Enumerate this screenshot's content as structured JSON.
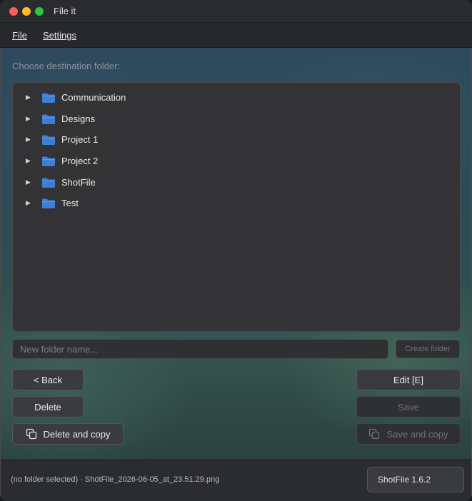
{
  "window": {
    "title": "File it"
  },
  "menu": {
    "file": "File",
    "settings": "Settings"
  },
  "main": {
    "choose_label": "Choose destination folder:",
    "folders": [
      {
        "label": "Communication",
        "icon": "folder-icon"
      },
      {
        "label": "Designs",
        "icon": "folder-icon"
      },
      {
        "label": "Project 1",
        "icon": "folder-icon"
      },
      {
        "label": "Project 2",
        "icon": "folder-icon"
      },
      {
        "label": "ShotFile",
        "icon": "folder-icon"
      },
      {
        "label": "Test",
        "icon": "folder-icon"
      }
    ],
    "new_folder": {
      "value": "",
      "placeholder": "New folder name..."
    },
    "create_folder_label": "Create folder"
  },
  "actions": {
    "back": "< Back",
    "delete": "Delete",
    "delete_and_copy": "Delete and copy",
    "edit": "Edit [E]",
    "save": "Save",
    "save_and_copy": "Save and copy"
  },
  "footer": {
    "status": "(no folder selected) · ShotFile_2026-06-05_at_23.51.29.png",
    "version": "ShotFile 1.6.2"
  },
  "colors": {
    "folder": "#3d7fd6",
    "traffic_close": "#ff5f57",
    "traffic_min": "#febc2e",
    "traffic_max": "#28c840"
  }
}
